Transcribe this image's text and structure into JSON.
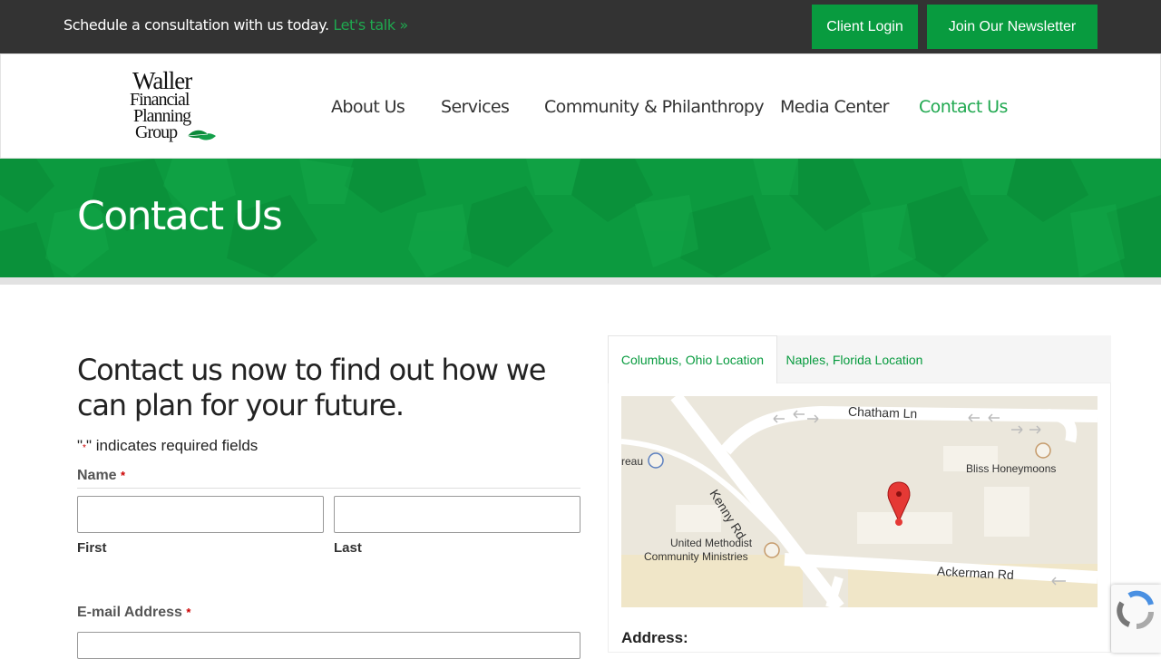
{
  "topbar": {
    "promo_text": "Schedule a consultation with us today.",
    "promo_link": "Let's talk »",
    "client_login": "Client Login",
    "newsletter": "Join Our Newsletter"
  },
  "logo": {
    "line1": "Waller",
    "line2": "Financial",
    "line3": "Planning",
    "line4": "Group"
  },
  "nav": {
    "items": [
      {
        "label": "About Us"
      },
      {
        "label": "Services"
      },
      {
        "label": "Community & Philanthropy"
      },
      {
        "label": "Media Center"
      },
      {
        "label": "Contact Us"
      }
    ],
    "active": "Contact Us"
  },
  "hero": {
    "title": "Contact Us"
  },
  "form": {
    "heading": "Contact us now to find out how we can plan for your future.",
    "required_note_prefix": "\"",
    "required_star": "*",
    "required_note_suffix": "\" indicates required fields",
    "name_label": "Name",
    "first_label": "First",
    "last_label": "Last",
    "email_label": "E-mail Address",
    "first_value": "",
    "last_value": "",
    "email_value": ""
  },
  "locations": {
    "tabs": [
      {
        "label": "Columbus, Ohio Location"
      },
      {
        "label": "Naples, Florida Location"
      }
    ],
    "active_tab": "Columbus, Ohio Location",
    "map_labels": {
      "chatham": "Chatham Ln",
      "kenny": "Kenny Rd",
      "ackerman": "Ackerman Rd",
      "bliss": "Bliss Honeymoons",
      "umcm1": "United Methodist",
      "umcm2": "Community Ministries",
      "reau": "reau"
    },
    "address_label": "Address:"
  },
  "colors": {
    "accent": "#089b3f",
    "topbar": "#333333",
    "link": "#1fa84f"
  }
}
